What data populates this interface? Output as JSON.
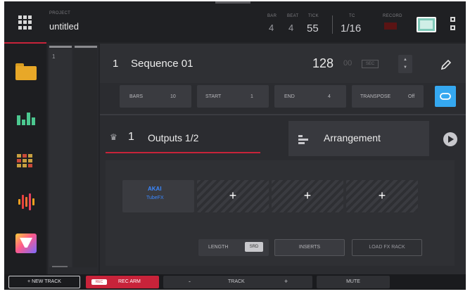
{
  "header": {
    "project_caption": "PROJECT",
    "project_name": "untitled",
    "bar_caption": "BAR",
    "bar_value": "4",
    "beat_caption": "BEAT",
    "beat_value": "4",
    "tick_caption": "TICK",
    "tick_value": "55",
    "tc_caption": "TC",
    "tc_value": "1/16",
    "swing_caption": "RECORD"
  },
  "sequence": {
    "number": "1",
    "name": "Sequence 01",
    "tempo": "128",
    "tempo_decimal": "00",
    "tempo_unit_label": "SEC"
  },
  "params": {
    "bars_label": "BARS",
    "bars_value": "10",
    "start_label": "START",
    "start_value": "1",
    "end_label": "END",
    "end_value": "4",
    "transpose_label": "TRANSPOSE",
    "transpose_value": "Off"
  },
  "track_strip": {
    "label": "1"
  },
  "tabs": {
    "outputs_number": "1",
    "outputs_name": "Outputs 1/2",
    "arrangement_label": "Arrangement"
  },
  "inserts": {
    "slot1_brand": "AKAI",
    "slot1_plugin": "TubeFX",
    "plus": "+"
  },
  "buttons": {
    "length_label": "LENGTH",
    "length_value": "SRD",
    "inserts_label": "INSERTS",
    "load_fx_label": "LOAD FX RACK"
  },
  "footer": {
    "new_track_label": "+   NEW TRACK",
    "rec_arm_badge": "REC",
    "rec_arm_label": "REC ARM",
    "track_minus": "-",
    "track_label": "TRACK",
    "track_plus": "+",
    "mute_label": "MUTE"
  },
  "icons": [
    "menu-grid-icon",
    "folder-icon",
    "mixer-icon",
    "grid-icon",
    "waveform-icon",
    "apps-icon",
    "pencil-icon",
    "loop-icon",
    "play-icon",
    "arrangement-icon"
  ],
  "colors": {
    "accent_red": "#c8233a",
    "loop_blue": "#35a8f0",
    "folder_yellow": "#e8a828",
    "mixer_green": "#4cc890",
    "akai_blue": "#3a88ff"
  }
}
